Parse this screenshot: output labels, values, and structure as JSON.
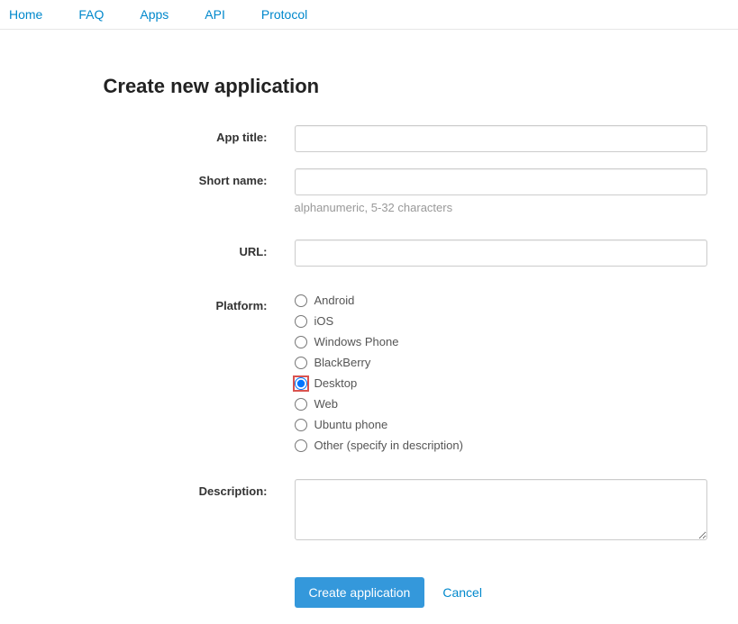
{
  "nav": {
    "items": [
      {
        "label": "Home"
      },
      {
        "label": "FAQ"
      },
      {
        "label": "Apps"
      },
      {
        "label": "API"
      },
      {
        "label": "Protocol"
      }
    ]
  },
  "page": {
    "title": "Create new application"
  },
  "form": {
    "app_title": {
      "label": "App title:",
      "value": ""
    },
    "short_name": {
      "label": "Short name:",
      "value": "",
      "help": "alphanumeric, 5-32 characters"
    },
    "url": {
      "label": "URL:",
      "value": ""
    },
    "platform": {
      "label": "Platform:",
      "selected": "Desktop",
      "options": [
        {
          "label": "Android"
        },
        {
          "label": "iOS"
        },
        {
          "label": "Windows Phone"
        },
        {
          "label": "BlackBerry"
        },
        {
          "label": "Desktop"
        },
        {
          "label": "Web"
        },
        {
          "label": "Ubuntu phone"
        },
        {
          "label": "Other (specify in description)"
        }
      ]
    },
    "description": {
      "label": "Description:",
      "value": ""
    },
    "actions": {
      "submit": "Create application",
      "cancel": "Cancel"
    }
  }
}
